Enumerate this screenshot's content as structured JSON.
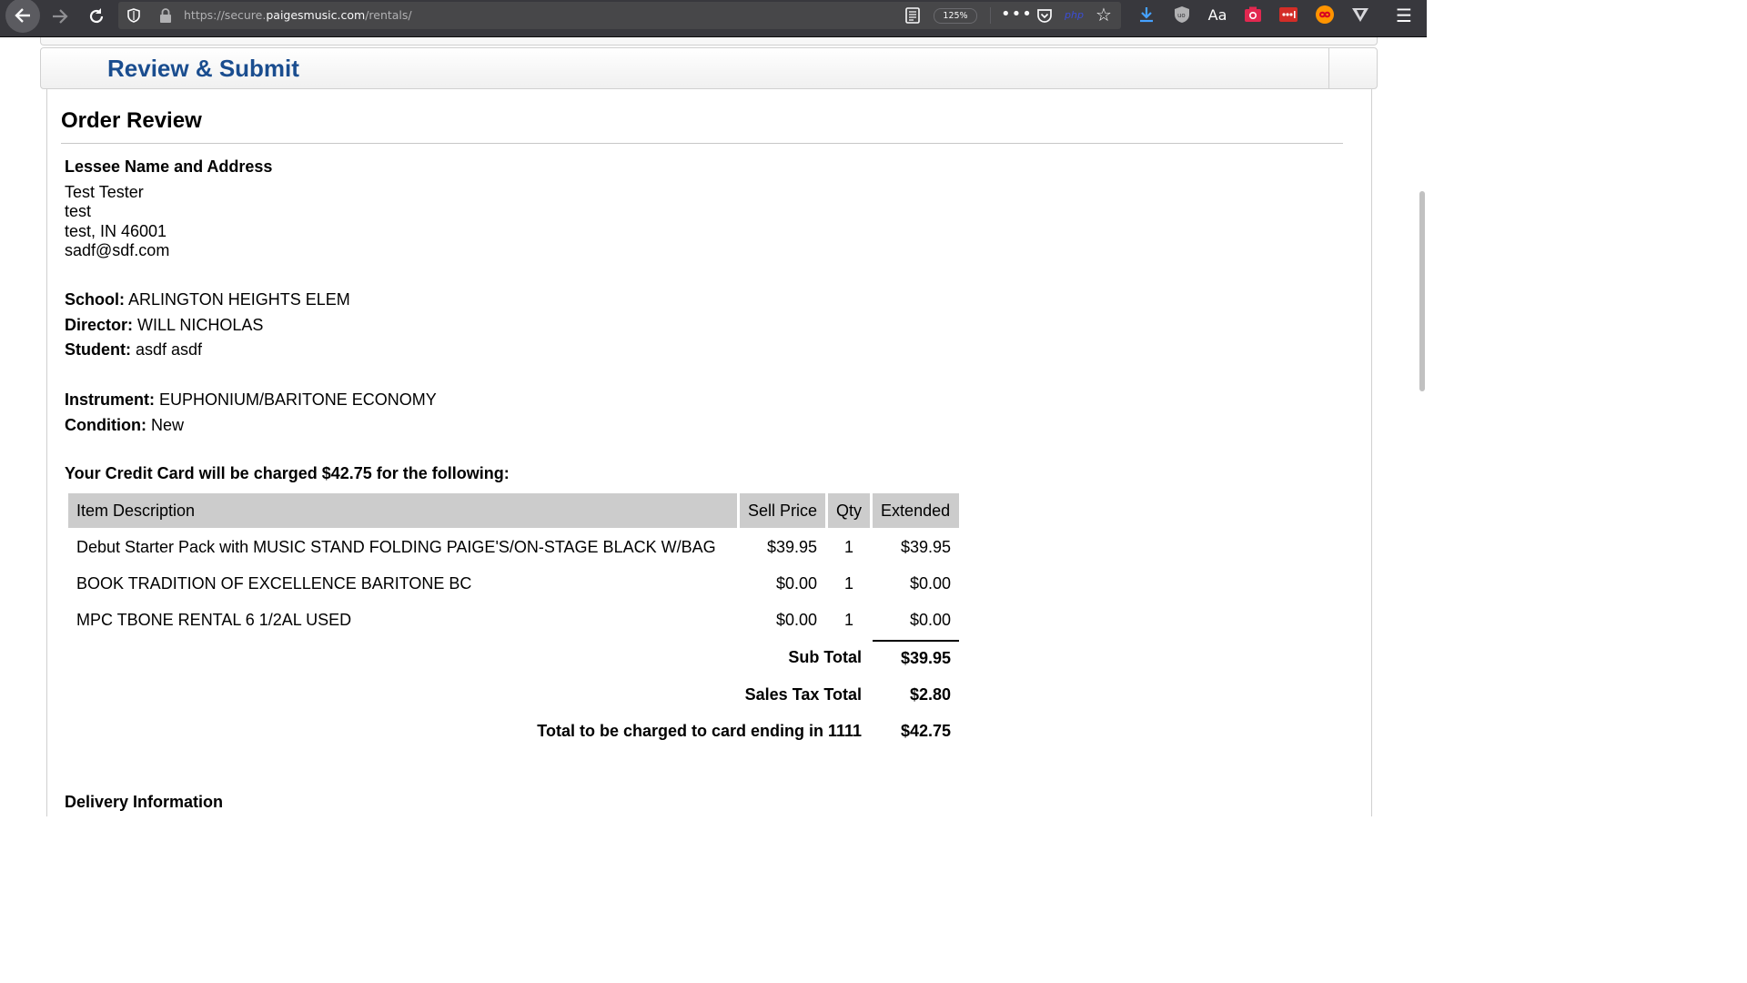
{
  "browser": {
    "url_prefix": "https://secure.",
    "url_domain": "paigesmusic.com",
    "url_path": "/rentals/",
    "zoom": "125%",
    "php_label": "php",
    "aa_label": "Aa"
  },
  "section": {
    "title": "Review & Submit"
  },
  "review": {
    "title": "Order Review",
    "lessee_heading": "Lessee Name and Address",
    "lessee_lines": [
      "Test Tester",
      "test",
      "test, IN 46001",
      "sadf@sdf.com"
    ],
    "school_label": "School:",
    "school": "ARLINGTON HEIGHTS ELEM",
    "director_label": "Director:",
    "director": "WILL NICHOLAS",
    "student_label": "Student:",
    "student": "asdf asdf",
    "instrument_label": "Instrument:",
    "instrument": "EUPHONIUM/BARITONE ECONOMY",
    "condition_label": "Condition:",
    "condition": "New",
    "charge_text": "Your Credit Card will be charged $42.75 for the following:"
  },
  "table": {
    "headers": [
      "Item Description",
      "Sell Price",
      "Qty",
      "Extended"
    ],
    "rows": [
      {
        "desc": "Debut Starter Pack with MUSIC STAND FOLDING PAIGE'S/ON-STAGE BLACK W/BAG",
        "price": "$39.95",
        "qty": "1",
        "ext": "$39.95"
      },
      {
        "desc": "BOOK TRADITION OF EXCELLENCE BARITONE BC",
        "price": "$0.00",
        "qty": "1",
        "ext": "$0.00"
      },
      {
        "desc": "MPC TBONE RENTAL 6 1/2AL USED",
        "price": "$0.00",
        "qty": "1",
        "ext": "$0.00"
      }
    ],
    "subtotal_label": "Sub Total",
    "subtotal": "$39.95",
    "tax_label": "Sales Tax Total",
    "tax": "$2.80",
    "total_label": "Total to be charged to card ending in 1111",
    "total": "$42.75"
  },
  "next_heading": "Delivery Information"
}
